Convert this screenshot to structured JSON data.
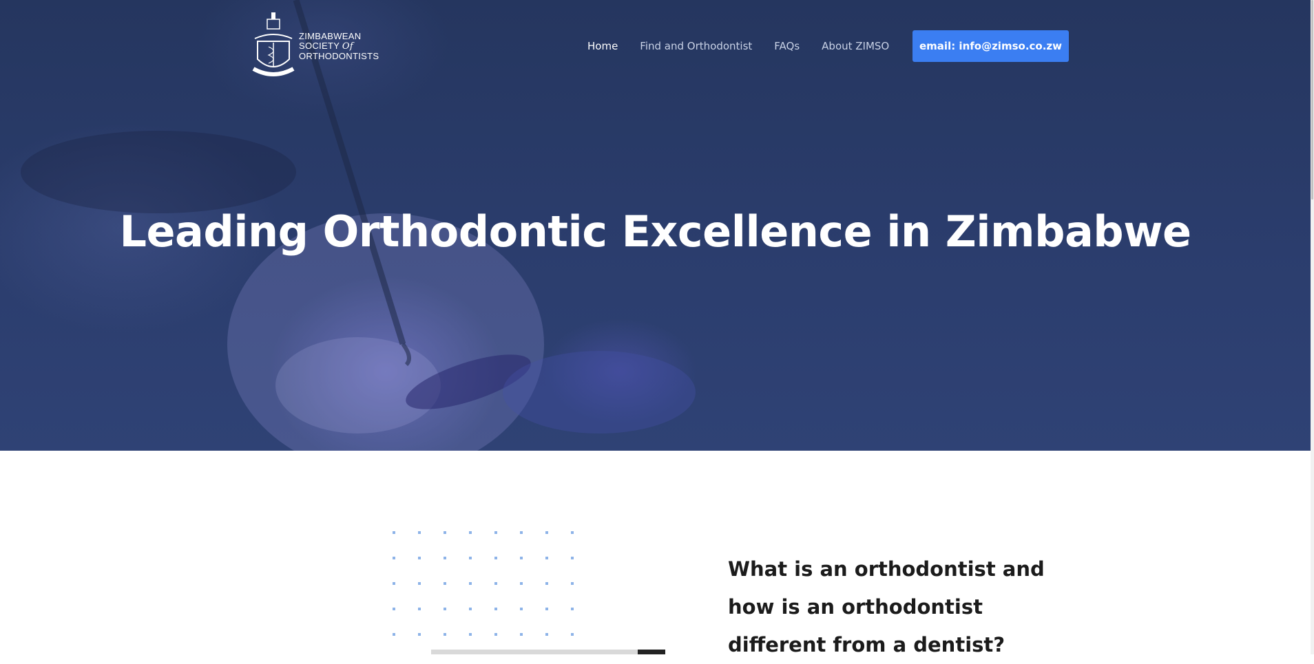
{
  "brand": {
    "line1": "ZIMBABWEAN",
    "line2": "SOCIETY",
    "line2_of": "Of",
    "line3": "ORTHODONTISTS",
    "logo_icon": "crest-icon"
  },
  "nav": {
    "items": [
      {
        "label": "Home",
        "active": true
      },
      {
        "label": "Find and Orthodontist",
        "active": false
      },
      {
        "label": "FAQs",
        "active": false
      },
      {
        "label": "About ZIMSO",
        "active": false
      }
    ],
    "cta_label": "email: info@zimso.co.zw"
  },
  "hero": {
    "title": "Leading Orthodontic Excellence in Zimbabwe"
  },
  "about": {
    "question": "What is an orthodontist and how is an orthodontist different from a dentist?"
  },
  "colors": {
    "hero_overlay": "#2b3d6d",
    "accent": "#3b7ef2",
    "dots": "#8db3e8",
    "heading": "#1b1b1b"
  }
}
